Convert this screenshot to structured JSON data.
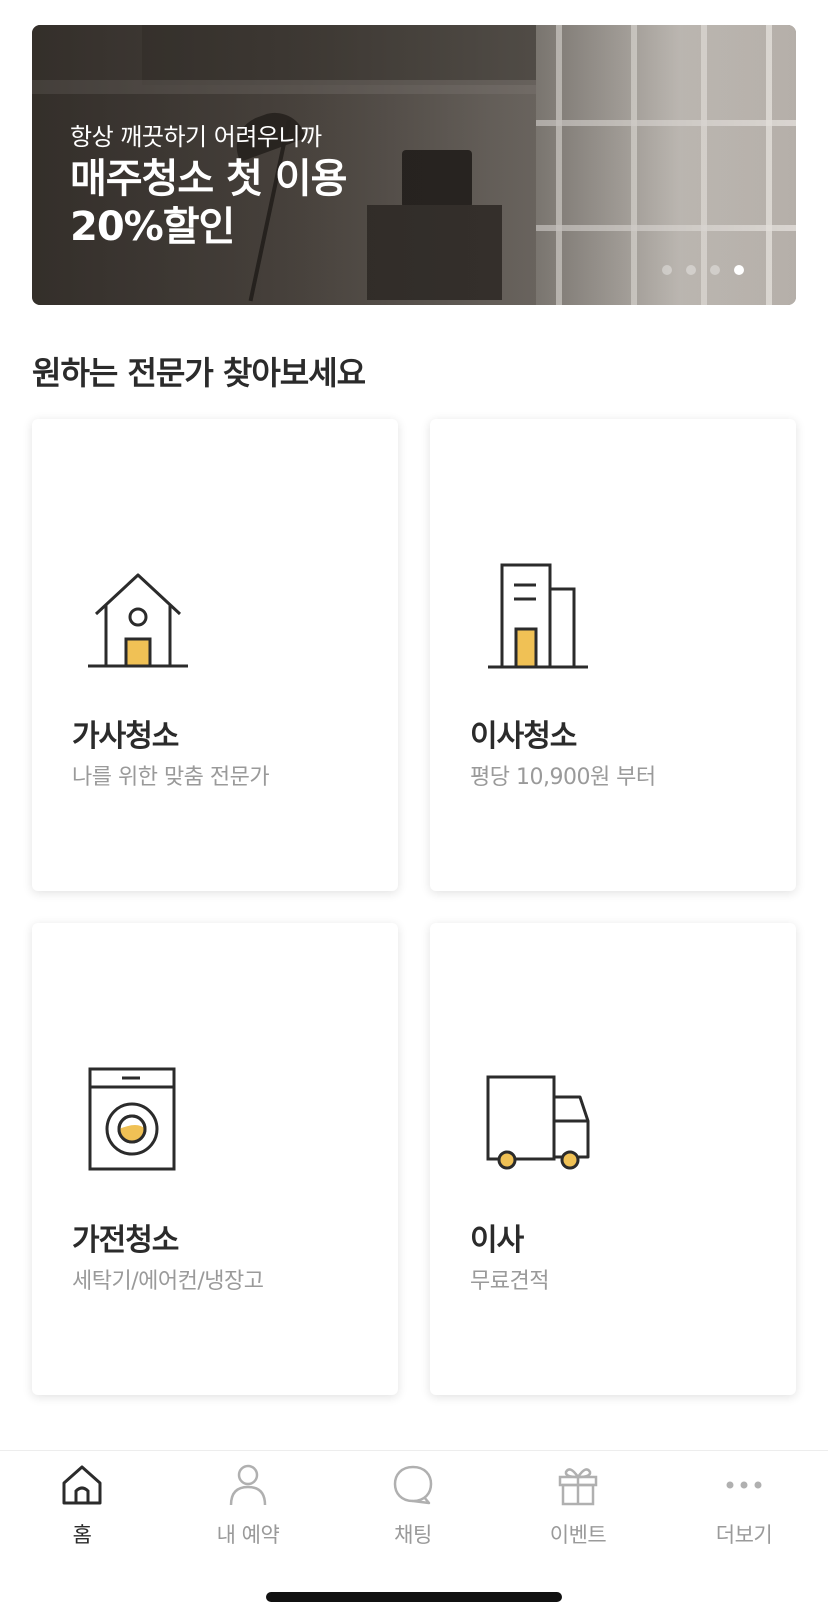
{
  "banner": {
    "subtitle": "항상 깨끗하기 어려우니까",
    "title_line1": "매주청소 첫 이용",
    "title_line2": "20%할인",
    "page_indicator": {
      "total": 4,
      "current": 4
    }
  },
  "section": {
    "title": "원하는 전문가 찾아보세요"
  },
  "cards": [
    {
      "name": "가사청소",
      "desc": "나를 위한 맞춤 전문가",
      "icon": "house-icon"
    },
    {
      "name": "이사청소",
      "desc": "평당 10,900원 부터",
      "icon": "building-icon"
    },
    {
      "name": "가전청소",
      "desc": "세탁기/에어컨/냉장고",
      "icon": "washing-machine-icon"
    },
    {
      "name": "이사",
      "desc": "무료견적",
      "icon": "truck-icon"
    }
  ],
  "nav": [
    {
      "label": "홈",
      "icon": "home-icon",
      "active": true
    },
    {
      "label": "내 예약",
      "icon": "person-icon",
      "active": false
    },
    {
      "label": "채팅",
      "icon": "chat-bubble-icon",
      "active": false
    },
    {
      "label": "이벤트",
      "icon": "gift-icon",
      "active": false
    },
    {
      "label": "더보기",
      "icon": "more-dots-icon",
      "active": false
    }
  ],
  "colors": {
    "accent": "#f0c155",
    "icon_stroke": "#2b2b2b",
    "muted_text": "#9a9a9a"
  }
}
